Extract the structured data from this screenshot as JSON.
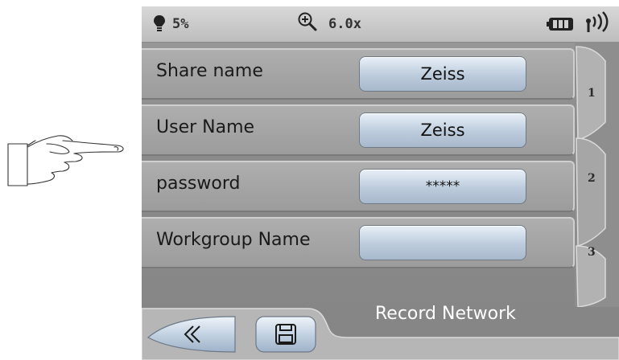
{
  "status": {
    "brightness": "5%",
    "zoom": "6.0x"
  },
  "form": {
    "rows": [
      {
        "label": "Share name",
        "value": "Zeiss"
      },
      {
        "label": "User Name",
        "value": "Zeiss"
      },
      {
        "label": "password",
        "value": "*****"
      },
      {
        "label": "Workgroup Name",
        "value": ""
      }
    ]
  },
  "tabs": [
    "1",
    "2",
    "3"
  ],
  "footer": {
    "title": "Record Network"
  },
  "icons": {
    "brightness": "lightbulb-icon",
    "zoom": "zoom-in-icon",
    "battery": "battery-icon",
    "signal": "wireless-signal-icon",
    "back": "double-chevron-left-icon",
    "save": "save-disk-icon",
    "pointer": "pointing-hand-icon"
  }
}
